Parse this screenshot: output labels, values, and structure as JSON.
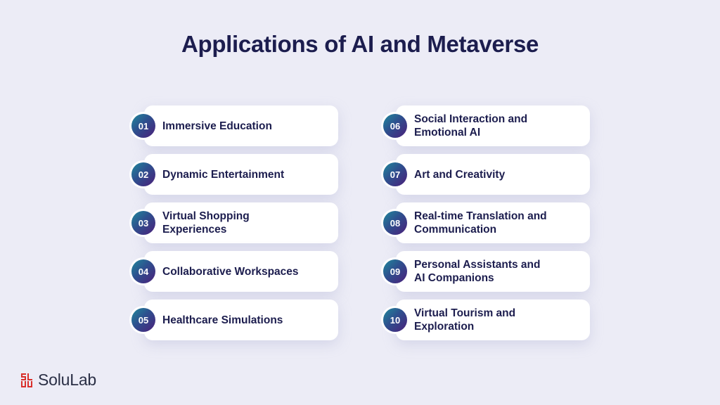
{
  "title": "Applications of AI and Metaverse",
  "colors": {
    "background": "#ececf6",
    "text": "#1c1d4e",
    "badge_gradient_start": "#1f8a9c",
    "badge_gradient_end": "#4b1f7a",
    "card": "#ffffff",
    "logo_red": "#d9302c"
  },
  "items": [
    {
      "number": "01",
      "label": "Immersive Education"
    },
    {
      "number": "02",
      "label": "Dynamic Entertainment"
    },
    {
      "number": "03",
      "label": "Virtual Shopping Experiences"
    },
    {
      "number": "04",
      "label": "Collaborative Workspaces"
    },
    {
      "number": "05",
      "label": "Healthcare Simulations"
    },
    {
      "number": "06",
      "label": "Social Interaction and Emotional AI"
    },
    {
      "number": "07",
      "label": "Art and Creativity"
    },
    {
      "number": "08",
      "label": "Real-time Translation and Communication"
    },
    {
      "number": "09",
      "label": "Personal Assistants and AI Companions"
    },
    {
      "number": "10",
      "label": "Virtual Tourism and Exploration"
    }
  ],
  "logo": {
    "icon": "solulab-logo-icon",
    "text": "SoluLab"
  }
}
